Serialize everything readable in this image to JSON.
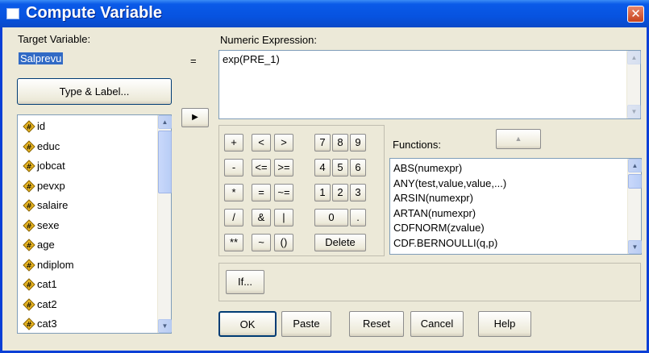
{
  "window": {
    "title": "Compute Variable",
    "close_glyph": "✕"
  },
  "target": {
    "label": "Target Variable:",
    "value": "Salprevu",
    "type_label_button": "Type & Label..."
  },
  "equals": "=",
  "move_button_glyph": "▶",
  "expression": {
    "label": "Numeric Expression:",
    "value": "exp(PRE_1)"
  },
  "variables": [
    "id",
    "educ",
    "jobcat",
    "pevxp",
    "salaire",
    "sexe",
    "age",
    "ndiplom",
    "cat1",
    "cat2",
    "cat3"
  ],
  "keypad": {
    "plus": "+",
    "lt": "<",
    "gt": ">",
    "k7": "7",
    "k8": "8",
    "k9": "9",
    "minus": "-",
    "le": "<=",
    "ge": ">=",
    "k4": "4",
    "k5": "5",
    "k6": "6",
    "mult": "*",
    "eq": "=",
    "ne": "~=",
    "k1": "1",
    "k2": "2",
    "k3": "3",
    "div": "/",
    "and": "&",
    "or": "|",
    "k0": "0",
    "dot": ".",
    "pow": "**",
    "not": "~",
    "parens": "()",
    "delete": "Delete"
  },
  "functions": {
    "label": "Functions:",
    "items": [
      "ABS(numexpr)",
      "ANY(test,value,value,...)",
      "ARSIN(numexpr)",
      "ARTAN(numexpr)",
      "CDFNORM(zvalue)",
      "CDF.BERNOULLI(q,p)"
    ]
  },
  "if_button": "If...",
  "actions": {
    "ok": "OK",
    "paste": "Paste",
    "reset": "Reset",
    "cancel": "Cancel",
    "help": "Help"
  },
  "colors": {
    "titlebar": "#0753e0",
    "selection": "#316ac5",
    "dialog_bg": "#ece9d8",
    "var_icon": "#e6b422"
  }
}
